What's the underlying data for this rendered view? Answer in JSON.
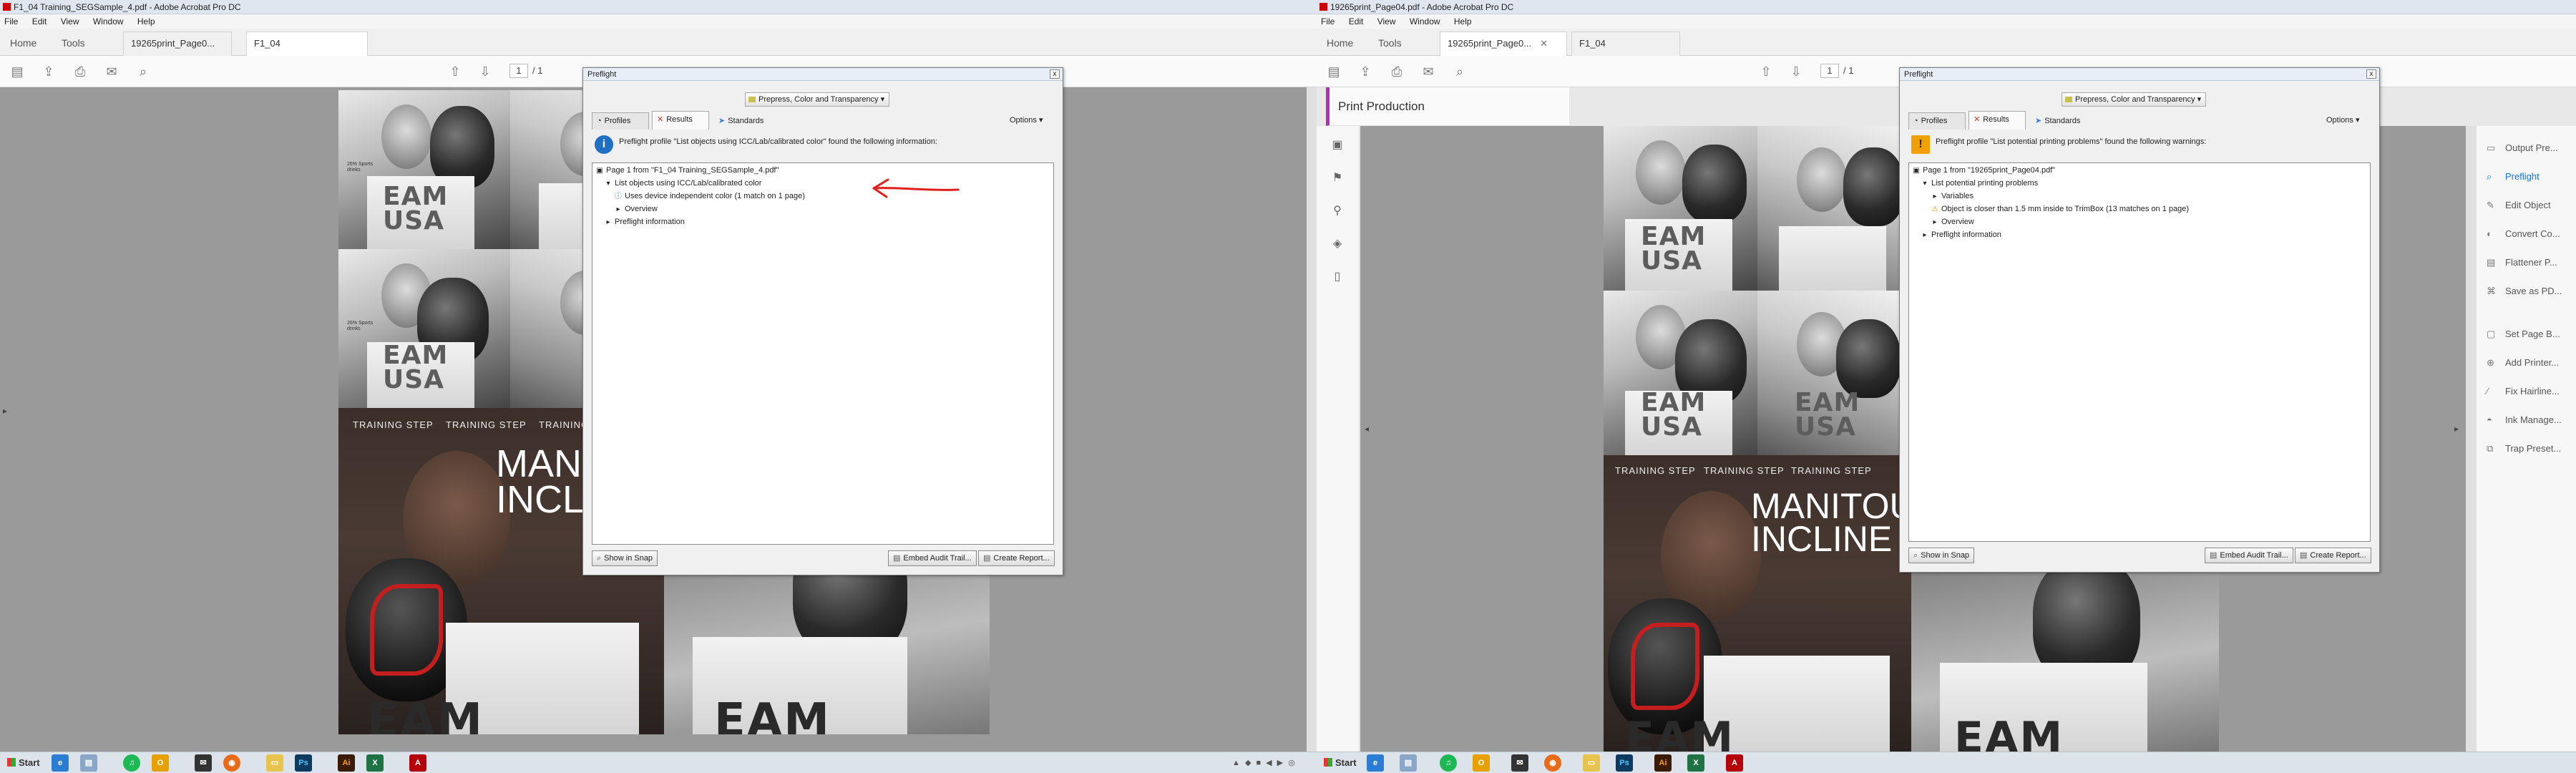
{
  "colors": {
    "accent": "#1473e6",
    "pp_bar": "#b02fb5",
    "arrow": "#e0201c",
    "warn": "#f0a000",
    "info": "#1f6fc4"
  },
  "left": {
    "title": "F1_04 Training_SEGSample_4.pdf - Adobe Acrobat Pro DC",
    "menu": [
      "File",
      "Edit",
      "View",
      "Window",
      "Help"
    ],
    "tabs": {
      "home": "Home",
      "tools": "Tools",
      "doc1": "19265print_Page0...",
      "doc2": "F1_04 Training_SEG..."
    },
    "page": {
      "current": "1",
      "total": "/ 1"
    },
    "artwork": {
      "usa": "EAM\nUSA",
      "stat1": "26% Sports drinks",
      "stat2": "26% Sports drinks",
      "training": [
        "TRAINING STEP",
        "TRAINING STEP",
        "TRAINING STEP"
      ],
      "manitou": "MANITOU\nINCLINE",
      "eam": "EAM"
    },
    "dialog": {
      "title": "Preflight",
      "close": "x",
      "profile": "Prepress, Color and Transparency",
      "tabs": [
        "Profiles",
        "Results",
        "Standards"
      ],
      "options": "Options",
      "message": "Preflight profile \"List objects using ICC/Lab/calibrated color\" found the following information:",
      "tree": [
        {
          "text": "Page 1 from \"F1_04 Training_SEGSample_4.pdf\"",
          "indent": 0,
          "glyph": "▣"
        },
        {
          "text": "List objects using ICC/Lab/calibrated color",
          "indent": 1,
          "glyph": "▾"
        },
        {
          "text": "Uses device independent color (1 match on 1 page)",
          "indent": 2,
          "glyph": "ⓘ"
        },
        {
          "text": "Overview",
          "indent": 2,
          "glyph": "▸"
        },
        {
          "text": "Preflight information",
          "indent": 1,
          "glyph": "▸"
        }
      ],
      "buttons": {
        "snap": "Show in Snap",
        "embed": "Embed Audit Trail...",
        "report": "Create Report..."
      }
    }
  },
  "right": {
    "title": "19265print_Page04.pdf - Adobe Acrobat Pro DC",
    "menu": [
      "File",
      "Edit",
      "View",
      "Window",
      "Help"
    ],
    "tabs": {
      "home": "Home",
      "tools": "Tools",
      "doc1": "19265print_Page0...",
      "doc2": "F1_04 Training_SEG..."
    },
    "page": {
      "current": "1",
      "total": "/ 1"
    },
    "print_production": "Print Production",
    "artwork": {
      "usa": "EAM\nUSA",
      "training": [
        "TRAINING STEP",
        "TRAINING STEP",
        "TRAINING STEP"
      ],
      "manitou": "MANITOU\nINCLINE",
      "eam": "EAM"
    },
    "tools": [
      "Output Pre...",
      "Preflight",
      "Edit Object",
      "Convert Co...",
      "Flattener P...",
      "Save as PD...",
      "Set Page B...",
      "Add Printer...",
      "Fix Hairline...",
      "Ink Manage...",
      "Trap Preset..."
    ],
    "dialog": {
      "title": "Preflight",
      "close": "x",
      "profile": "Prepress, Color and Transparency",
      "tabs": [
        "Profiles",
        "Results",
        "Standards"
      ],
      "options": "Options",
      "message": "Preflight profile \"List potential printing problems\" found the following warnings:",
      "tree": [
        {
          "text": "Page 1 from \"19265print_Page04.pdf\"",
          "indent": 0,
          "glyph": "▣"
        },
        {
          "text": "List potential printing problems",
          "indent": 1,
          "glyph": "▾"
        },
        {
          "text": "Variables",
          "indent": 2,
          "glyph": "▸"
        },
        {
          "text": "Object is closer than 1.5 mm inside to TrimBox (13 matches on 1 page)",
          "indent": 2,
          "glyph": "⚠"
        },
        {
          "text": "Overview",
          "indent": 2,
          "glyph": "▸"
        },
        {
          "text": "Preflight information",
          "indent": 1,
          "glyph": "▸"
        }
      ],
      "buttons": {
        "snap": "Show in Snap",
        "embed": "Embed Audit Trail...",
        "report": "Create Report..."
      }
    }
  },
  "taskbar": {
    "start": "Start",
    "apps": [
      "IE",
      "Files",
      "Spotify",
      "Outlook",
      "Explorer",
      "Firefox",
      "Folder",
      "Ps",
      "Ai",
      "Excel",
      "Acrobat"
    ],
    "tray": "▲ ◆ ■ ◀ ▶ ◎"
  }
}
